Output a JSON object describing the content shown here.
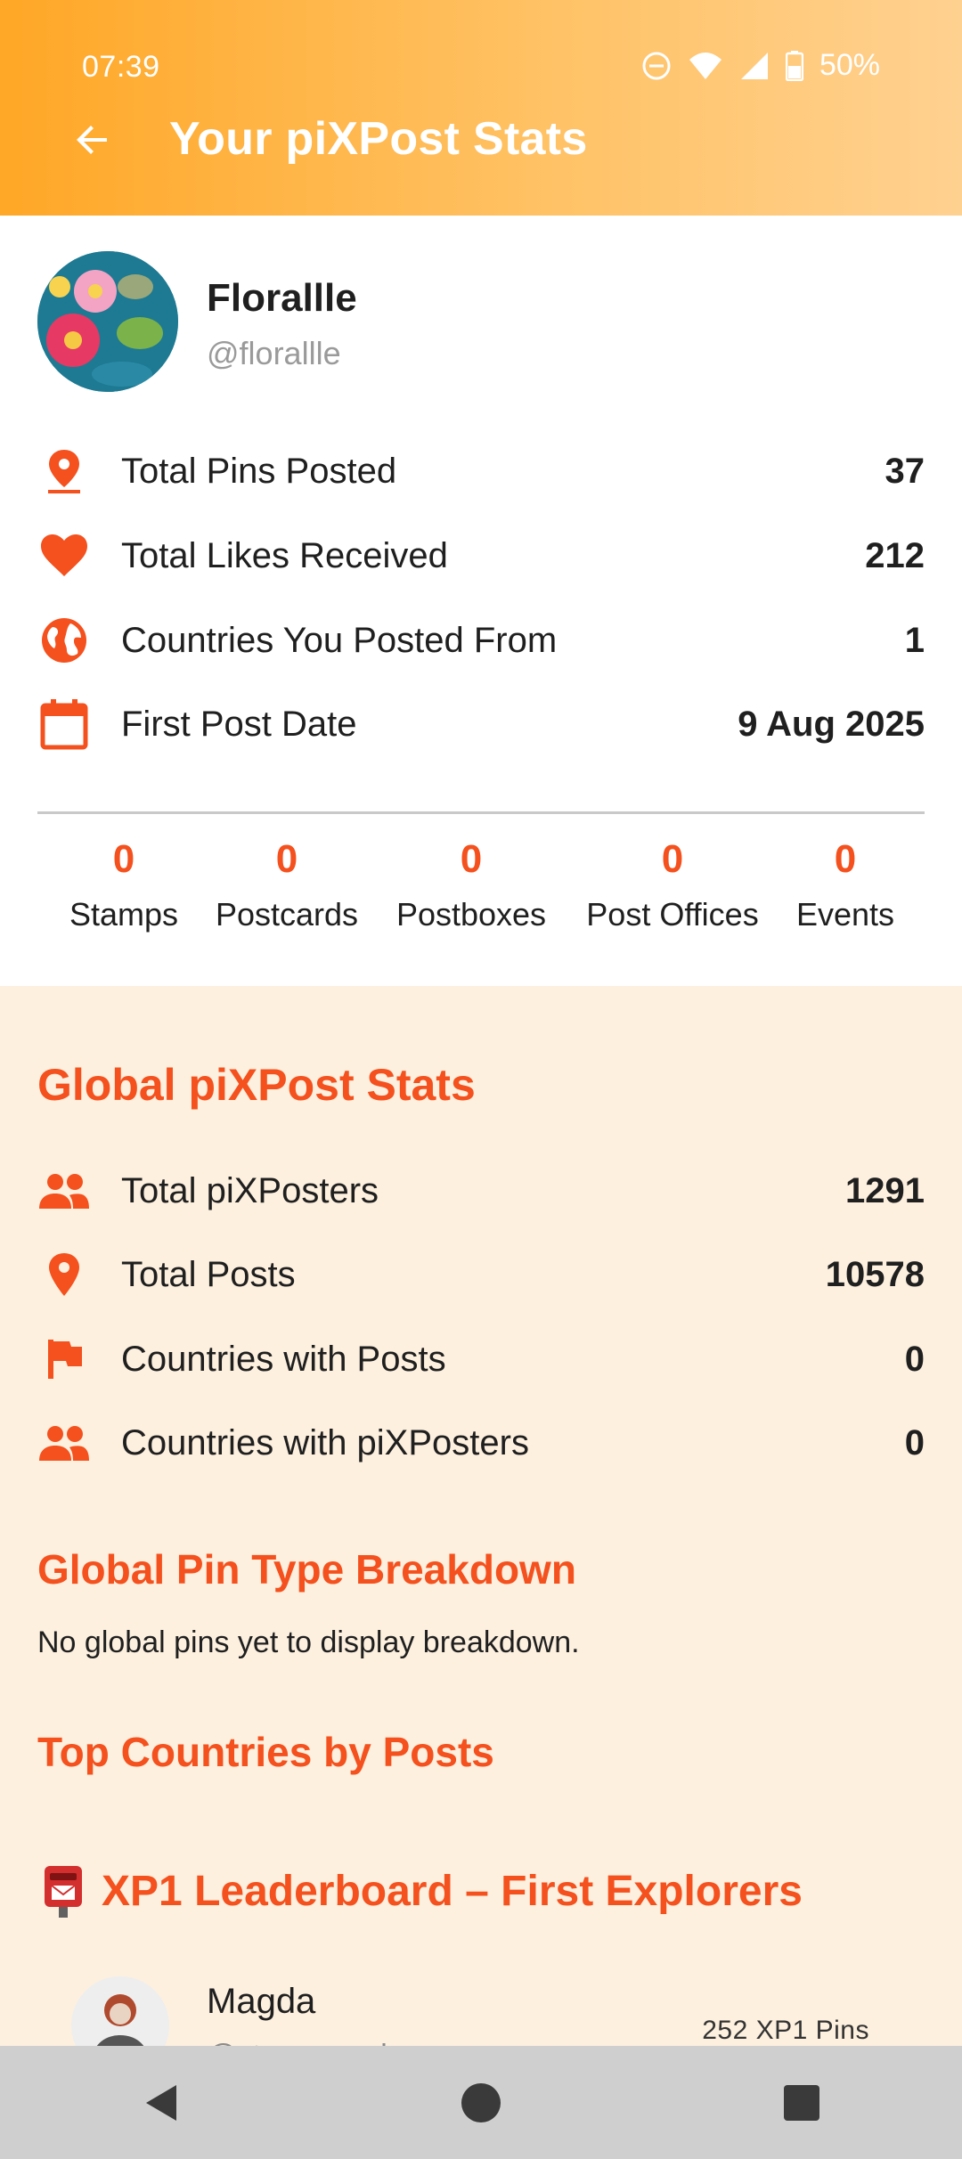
{
  "status_bar": {
    "time": "07:39",
    "battery": "50%"
  },
  "header": {
    "title": "Your piXPost Stats"
  },
  "profile": {
    "name": "Florallle",
    "handle": "@florallle",
    "stats": [
      {
        "label": "Total Pins Posted",
        "value": "37",
        "icon": "pin-icon"
      },
      {
        "label": "Total Likes Received",
        "value": "212",
        "icon": "heart-icon"
      },
      {
        "label": "Countries You Posted From",
        "value": "1",
        "icon": "globe-icon"
      },
      {
        "label": "First Post Date",
        "value": "9 Aug 2025",
        "icon": "calendar-icon"
      }
    ],
    "counters": [
      {
        "value": "0",
        "label": "Stamps"
      },
      {
        "value": "0",
        "label": "Postcards"
      },
      {
        "value": "0",
        "label": "Postboxes"
      },
      {
        "value": "0",
        "label": "Post Offices"
      },
      {
        "value": "0",
        "label": "Events"
      }
    ]
  },
  "global": {
    "title": "Global piXPost Stats",
    "stats": [
      {
        "label": "Total piXPosters",
        "value": "1291",
        "icon": "people-icon"
      },
      {
        "label": "Total Posts",
        "value": "10578",
        "icon": "pin-icon"
      },
      {
        "label": "Countries with Posts",
        "value": "0",
        "icon": "flag-icon"
      },
      {
        "label": "Countries with piXPosters",
        "value": "0",
        "icon": "people-icon"
      }
    ],
    "pin_breakdown_title": "Global Pin Type Breakdown",
    "pin_breakdown_empty": "No global pins yet to display breakdown.",
    "top_countries_title": "Top Countries by Posts",
    "leaderboard_title": "XP1 Leaderboard – First Explorers",
    "leaderboard": [
      {
        "name": "Magda",
        "handle": "@stamp_and_away",
        "pins": "252 XP1 Pins"
      }
    ]
  },
  "colors": {
    "accent": "#F4511E",
    "header_start": "#FFA726",
    "header_end": "#FFD190",
    "section_bg": "#FDF0DF"
  }
}
